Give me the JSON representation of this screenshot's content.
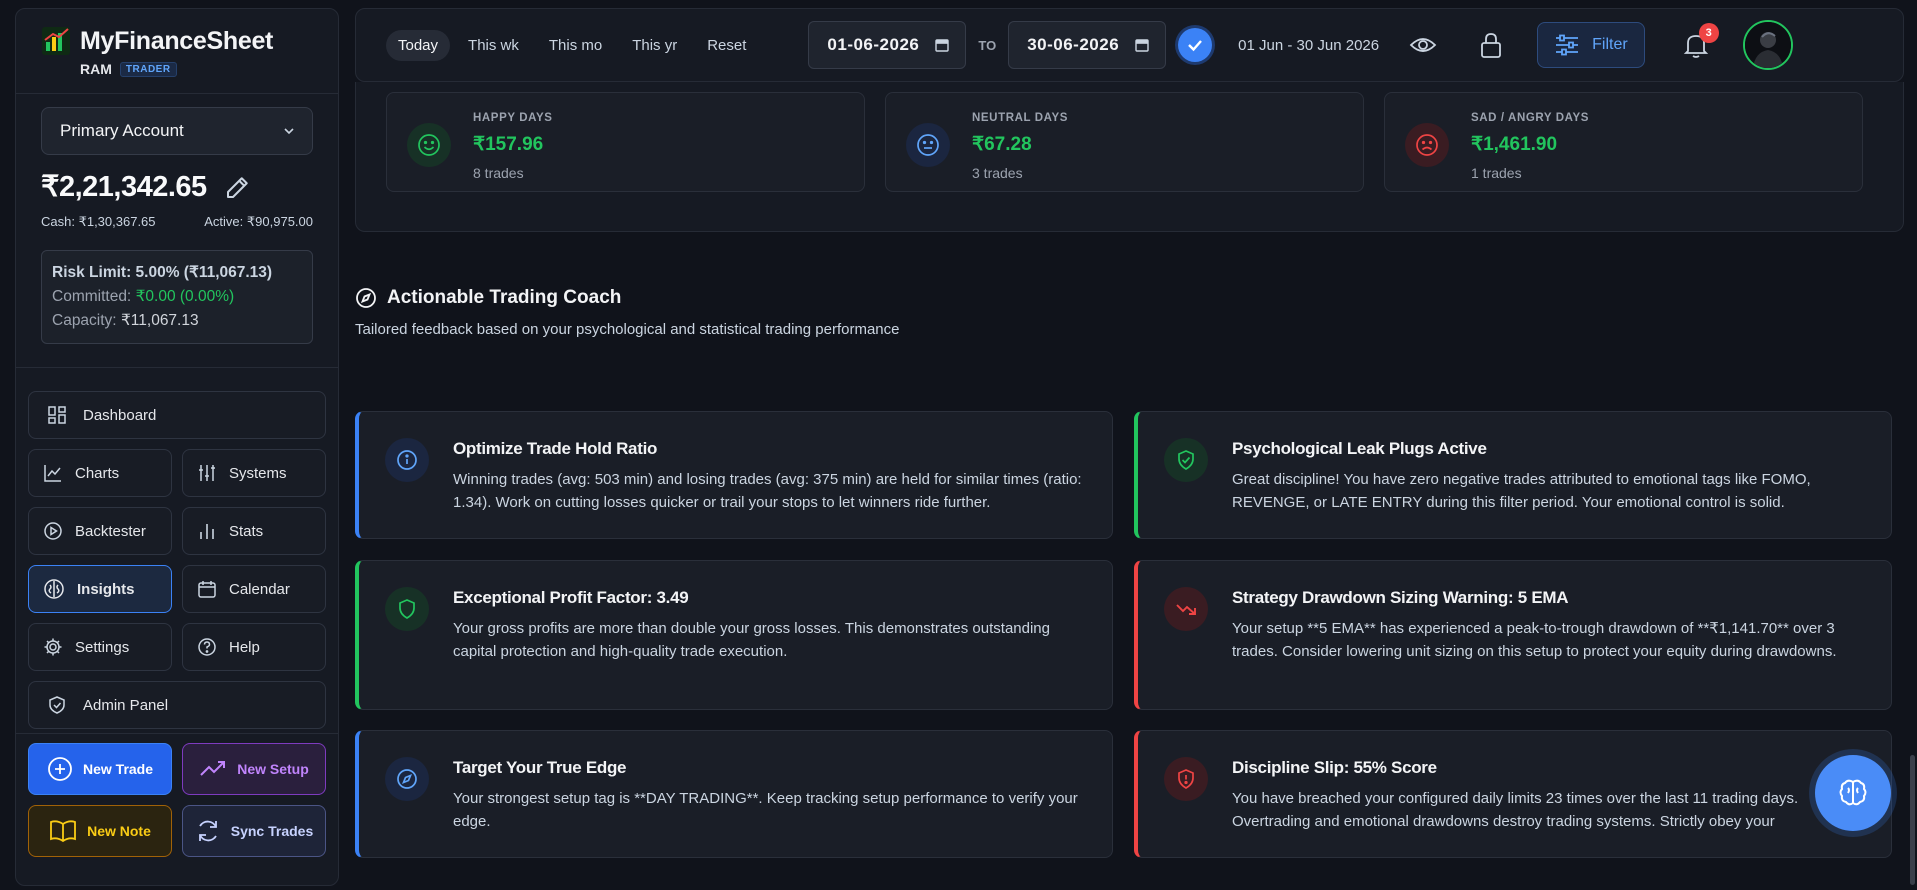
{
  "brand": {
    "name": "MyFinanceSheet",
    "user": "RAM",
    "role": "TRADER"
  },
  "account": {
    "selected": "Primary Account",
    "balance": "₹2,21,342.65",
    "cash": "Cash: ₹1,30,367.65",
    "active": "Active: ₹90,975.00",
    "risk_limit": "Risk Limit: 5.00% (₹11,067.13)",
    "committed_label": "Committed:",
    "committed_value": "₹0.00 (0.00%)",
    "capacity_label": "Capacity:",
    "capacity_value": "₹11,067.13"
  },
  "nav": {
    "dashboard": "Dashboard",
    "charts": "Charts",
    "systems": "Systems",
    "backtester": "Backtester",
    "stats": "Stats",
    "insights": "Insights",
    "calendar": "Calendar",
    "settings": "Settings",
    "help": "Help",
    "admin": "Admin Panel",
    "active": "insights"
  },
  "actions": {
    "new_trade": "New Trade",
    "new_setup": "New Setup",
    "new_note": "New Note",
    "sync_trades": "Sync Trades"
  },
  "topbar": {
    "ranges": [
      "Today",
      "This wk",
      "This mo",
      "This yr",
      "Reset"
    ],
    "active_range": "Today",
    "from_date": "01-06-2026",
    "to_label": "TO",
    "to_date": "30-06-2026",
    "range_text": "01 Jun - 30 Jun 2026",
    "filter_label": "Filter",
    "notification_count": "3"
  },
  "moods": [
    {
      "label": "HAPPY DAYS",
      "value": "₹157.96",
      "count": "8 trades",
      "icon": "smile-icon",
      "color": "#22c55e"
    },
    {
      "label": "NEUTRAL DAYS",
      "value": "₹67.28",
      "count": "3 trades",
      "icon": "neutral-face-icon",
      "color": "#60a5fa"
    },
    {
      "label": "SAD / ANGRY DAYS",
      "value": "₹1,461.90",
      "count": "1 trades",
      "icon": "frown-icon",
      "color": "#ef4444"
    }
  ],
  "coach": {
    "title": "Actionable Trading Coach",
    "subtitle": "Tailored feedback based on your psychological and statistical trading performance",
    "tips": [
      {
        "title": "Optimize Trade Hold Ratio",
        "body": "Winning trades (avg: 503 min) and losing trades (avg: 375 min) are held for similar times (ratio: 1.34). Work on cutting losses quicker or trail your stops to let winners ride further.",
        "tone": "blue",
        "icon": "info-icon"
      },
      {
        "title": "Psychological Leak Plugs Active",
        "body": "Great discipline! You have zero negative trades attributed to emotional tags like FOMO, REVENGE, or LATE ENTRY during this filter period. Your emotional control is solid.",
        "tone": "green",
        "icon": "shield-check-icon"
      },
      {
        "title": "Exceptional Profit Factor: 3.49",
        "body": "Your gross profits are more than double your gross losses. This demonstrates outstanding capital protection and high-quality trade execution.",
        "tone": "green",
        "icon": "shield-icon"
      },
      {
        "title": "Strategy Drawdown Sizing Warning: 5 EMA",
        "body": "Your setup **5 EMA** has experienced a peak-to-trough drawdown of **₹1,141.70** over 3 trades. Consider lowering unit sizing on this setup to protect your equity during drawdowns.",
        "tone": "red",
        "icon": "trending-down-icon"
      },
      {
        "title": "Target Your True Edge",
        "body": "Your strongest setup tag is **DAY TRADING**. Keep tracking setup performance to verify your edge.",
        "tone": "blue",
        "icon": "compass-icon"
      },
      {
        "title": "Discipline Slip: 55% Score",
        "body": "You have breached your configured daily limits 23 times over the last 11 trading days. Overtrading and emotional drawdowns destroy trading systems. Strictly obey your",
        "tone": "red",
        "icon": "shield-alert-icon"
      }
    ]
  },
  "colors": {
    "accent": "#3b82f6",
    "positive": "#22c55e",
    "negative": "#ef4444"
  }
}
